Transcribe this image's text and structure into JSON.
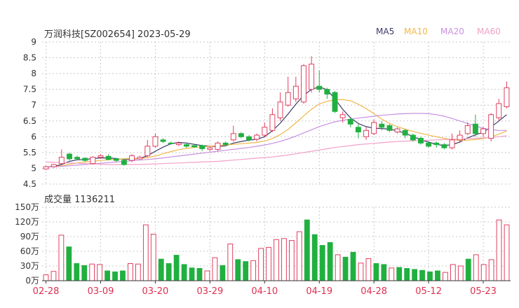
{
  "header": {
    "title": "万润科技[SZ002654] 2023-05-29",
    "ma_labels": [
      "MA5",
      "MA10",
      "MA20",
      "MA60"
    ],
    "ma_colors": [
      "#3a3a6a",
      "#f0b84a",
      "#c890e0",
      "#f2a0c8"
    ]
  },
  "volume_header": {
    "title": "成交量 1136211"
  },
  "colors": {
    "up": "#e04060",
    "down": "#20b040",
    "grid": "#c8c8c8",
    "axis_text": "#333333",
    "date_text": "#e03050"
  },
  "chart_data": [
    {
      "type": "candlestick",
      "title": "万润科技[SZ002654] 2023-05-29",
      "y_ticks": [
        "9",
        "8.5",
        "8",
        "7.5",
        "7",
        "6.5",
        "6",
        "5.5",
        "5",
        "4.5"
      ],
      "ylim": [
        4.5,
        9
      ],
      "x_ticks": [
        "02-28",
        "03-09",
        "03-20",
        "03-29",
        "04-10",
        "04-19",
        "04-28",
        "05-12",
        "05-23"
      ],
      "x_tick_index": [
        0,
        7,
        14,
        21,
        28,
        35,
        42,
        49,
        56
      ],
      "candles": [
        [
          4.98,
          5.05,
          4.95,
          5.08
        ],
        [
          5.05,
          5.12,
          5.02,
          5.14
        ],
        [
          5.15,
          5.35,
          5.1,
          5.6
        ],
        [
          5.45,
          5.3,
          5.25,
          5.5
        ],
        [
          5.35,
          5.3,
          5.25,
          5.4
        ],
        [
          5.32,
          5.25,
          5.2,
          5.35
        ],
        [
          5.15,
          5.35,
          5.12,
          5.38
        ],
        [
          5.35,
          5.4,
          5.3,
          5.45
        ],
        [
          5.38,
          5.28,
          5.25,
          5.45
        ],
        [
          5.3,
          5.25,
          5.2,
          5.33
        ],
        [
          5.25,
          5.12,
          5.08,
          5.3
        ],
        [
          5.25,
          5.4,
          5.2,
          5.45
        ],
        [
          5.3,
          5.35,
          5.28,
          5.4
        ],
        [
          5.4,
          5.7,
          5.35,
          5.9
        ],
        [
          5.7,
          6.0,
          5.65,
          6.1
        ],
        [
          5.9,
          5.85,
          5.8,
          5.95
        ],
        [
          5.8,
          5.78,
          5.75,
          5.85
        ],
        [
          5.75,
          5.8,
          5.7,
          5.85
        ],
        [
          5.75,
          5.7,
          5.65,
          5.8
        ],
        [
          5.72,
          5.68,
          5.65,
          5.75
        ],
        [
          5.72,
          5.62,
          5.55,
          5.75
        ],
        [
          5.6,
          5.65,
          5.55,
          5.7
        ],
        [
          5.6,
          5.8,
          5.55,
          5.85
        ],
        [
          5.8,
          5.75,
          5.7,
          5.85
        ],
        [
          5.9,
          6.1,
          5.85,
          6.35
        ],
        [
          6.1,
          6.0,
          5.95,
          6.15
        ],
        [
          6.0,
          5.9,
          5.85,
          6.05
        ],
        [
          5.92,
          6.05,
          5.85,
          6.1
        ],
        [
          6.05,
          6.3,
          6.0,
          6.45
        ],
        [
          6.2,
          6.7,
          6.15,
          6.9
        ],
        [
          6.6,
          7.1,
          6.5,
          7.4
        ],
        [
          7.0,
          7.4,
          6.95,
          7.9
        ],
        [
          7.2,
          7.6,
          7.1,
          7.9
        ],
        [
          7.1,
          8.25,
          7.05,
          8.3
        ],
        [
          7.5,
          8.3,
          7.4,
          8.55
        ],
        [
          7.6,
          7.5,
          7.4,
          8.1
        ],
        [
          7.5,
          7.35,
          7.2,
          7.55
        ],
        [
          7.4,
          6.8,
          6.75,
          7.45
        ],
        [
          6.6,
          6.7,
          6.45,
          6.8
        ],
        [
          6.55,
          6.4,
          6.3,
          6.6
        ],
        [
          6.3,
          6.15,
          5.95,
          6.4
        ],
        [
          6.0,
          6.2,
          5.9,
          6.3
        ],
        [
          6.1,
          6.45,
          6.05,
          6.55
        ],
        [
          6.4,
          6.3,
          6.2,
          6.5
        ],
        [
          6.35,
          6.2,
          6.15,
          6.4
        ],
        [
          6.15,
          6.25,
          6.1,
          6.3
        ],
        [
          6.2,
          6.05,
          5.95,
          6.25
        ],
        [
          6.05,
          5.9,
          5.85,
          6.1
        ],
        [
          5.95,
          5.8,
          5.75,
          6.0
        ],
        [
          5.8,
          5.7,
          5.65,
          5.85
        ],
        [
          5.8,
          5.75,
          5.65,
          5.85
        ],
        [
          5.75,
          5.65,
          5.6,
          5.8
        ],
        [
          5.65,
          5.9,
          5.6,
          6.1
        ],
        [
          5.9,
          6.05,
          5.8,
          6.2
        ],
        [
          6.1,
          6.35,
          6.05,
          6.45
        ],
        [
          6.4,
          6.1,
          6.0,
          6.7
        ],
        [
          6.1,
          6.25,
          6.0,
          6.3
        ],
        [
          5.95,
          6.7,
          5.85,
          6.75
        ],
        [
          6.6,
          7.05,
          6.5,
          7.2
        ],
        [
          6.95,
          7.55,
          6.9,
          7.75
        ]
      ],
      "ma": {
        "MA5": [
          5.04,
          5.06,
          5.12,
          5.22,
          5.27,
          5.28,
          5.31,
          5.33,
          5.33,
          5.31,
          5.28,
          5.29,
          5.31,
          5.4,
          5.54,
          5.67,
          5.78,
          5.82,
          5.8,
          5.76,
          5.72,
          5.7,
          5.69,
          5.71,
          5.8,
          5.85,
          5.89,
          5.92,
          6.0,
          6.19,
          6.43,
          6.72,
          7.03,
          7.31,
          7.5,
          7.58,
          7.49,
          7.2,
          6.87,
          6.6,
          6.42,
          6.32,
          6.27,
          6.26,
          6.24,
          6.19,
          6.11,
          6.01,
          5.9,
          5.83,
          5.76,
          5.72,
          5.75,
          5.83,
          5.96,
          6.06,
          6.14,
          6.31,
          6.5,
          6.7
        ],
        "MA10": [
          5.04,
          5.05,
          5.08,
          5.13,
          5.17,
          5.2,
          5.22,
          5.25,
          5.27,
          5.29,
          5.3,
          5.31,
          5.31,
          5.34,
          5.39,
          5.46,
          5.53,
          5.59,
          5.63,
          5.66,
          5.68,
          5.7,
          5.72,
          5.74,
          5.76,
          5.78,
          5.8,
          5.82,
          5.86,
          5.94,
          6.07,
          6.23,
          6.44,
          6.66,
          6.87,
          7.04,
          7.12,
          7.17,
          7.18,
          7.14,
          7.03,
          6.89,
          6.73,
          6.56,
          6.42,
          6.32,
          6.24,
          6.17,
          6.11,
          6.05,
          6.0,
          5.95,
          5.91,
          5.88,
          5.89,
          5.91,
          5.94,
          6.0,
          6.08,
          6.18
        ],
        "MA20": [
          5.04,
          5.05,
          5.06,
          5.08,
          5.1,
          5.12,
          5.14,
          5.16,
          5.18,
          5.2,
          5.22,
          5.24,
          5.26,
          5.28,
          5.3,
          5.33,
          5.36,
          5.39,
          5.42,
          5.45,
          5.48,
          5.51,
          5.54,
          5.57,
          5.6,
          5.63,
          5.66,
          5.7,
          5.74,
          5.79,
          5.85,
          5.93,
          6.02,
          6.12,
          6.22,
          6.32,
          6.4,
          6.47,
          6.52,
          6.56,
          6.59,
          6.62,
          6.65,
          6.68,
          6.7,
          6.72,
          6.73,
          6.74,
          6.74,
          6.73,
          6.7,
          6.65,
          6.58,
          6.5,
          6.42,
          6.34,
          6.27,
          6.22,
          6.2,
          6.2
        ],
        "MA60": [
          5.2,
          5.19,
          5.18,
          5.17,
          5.16,
          5.15,
          5.14,
          5.13,
          5.12,
          5.12,
          5.12,
          5.12,
          5.12,
          5.13,
          5.14,
          5.15,
          5.16,
          5.17,
          5.18,
          5.19,
          5.2,
          5.21,
          5.22,
          5.24,
          5.26,
          5.28,
          5.3,
          5.32,
          5.34,
          5.36,
          5.39,
          5.42,
          5.46,
          5.5,
          5.54,
          5.58,
          5.62,
          5.66,
          5.69,
          5.72,
          5.75,
          5.77,
          5.79,
          5.81,
          5.83,
          5.85,
          5.86,
          5.87,
          5.88,
          5.89,
          5.9,
          5.91,
          5.92,
          5.93,
          5.94,
          5.95,
          5.96,
          5.98,
          6.0,
          6.03
        ]
      }
    },
    {
      "type": "bar",
      "title": "成交量 1136211",
      "y_ticks": [
        "150万",
        "120万",
        "90万",
        "60万",
        "30万",
        "0万"
      ],
      "ylim": [
        0,
        150
      ],
      "unit": "万",
      "values": [
        12,
        19,
        93,
        69,
        35,
        31,
        34,
        33,
        20,
        18,
        20,
        35,
        34,
        114,
        95,
        44,
        35,
        52,
        33,
        26,
        25,
        20,
        47,
        31,
        75,
        43,
        39,
        41,
        66,
        68,
        84,
        86,
        82,
        100,
        124,
        94,
        72,
        78,
        53,
        48,
        58,
        36,
        45,
        35,
        33,
        26,
        27,
        25,
        23,
        21,
        18,
        20,
        17,
        33,
        30,
        44,
        53,
        33,
        43,
        124,
        114
      ],
      "directions": [
        "up",
        "up",
        "up",
        "down",
        "down",
        "down",
        "up",
        "up",
        "down",
        "down",
        "down",
        "up",
        "up",
        "up",
        "up",
        "down",
        "down",
        "down",
        "down",
        "down",
        "down",
        "up",
        "up",
        "down",
        "up",
        "down",
        "down",
        "up",
        "up",
        "up",
        "up",
        "up",
        "up",
        "up",
        "down",
        "down",
        "down",
        "down",
        "up",
        "down",
        "down",
        "up",
        "up",
        "down",
        "down",
        "up",
        "down",
        "down",
        "down",
        "down",
        "down",
        "down",
        "up",
        "up",
        "up",
        "down",
        "up",
        "up",
        "up",
        "up",
        "up"
      ]
    }
  ]
}
